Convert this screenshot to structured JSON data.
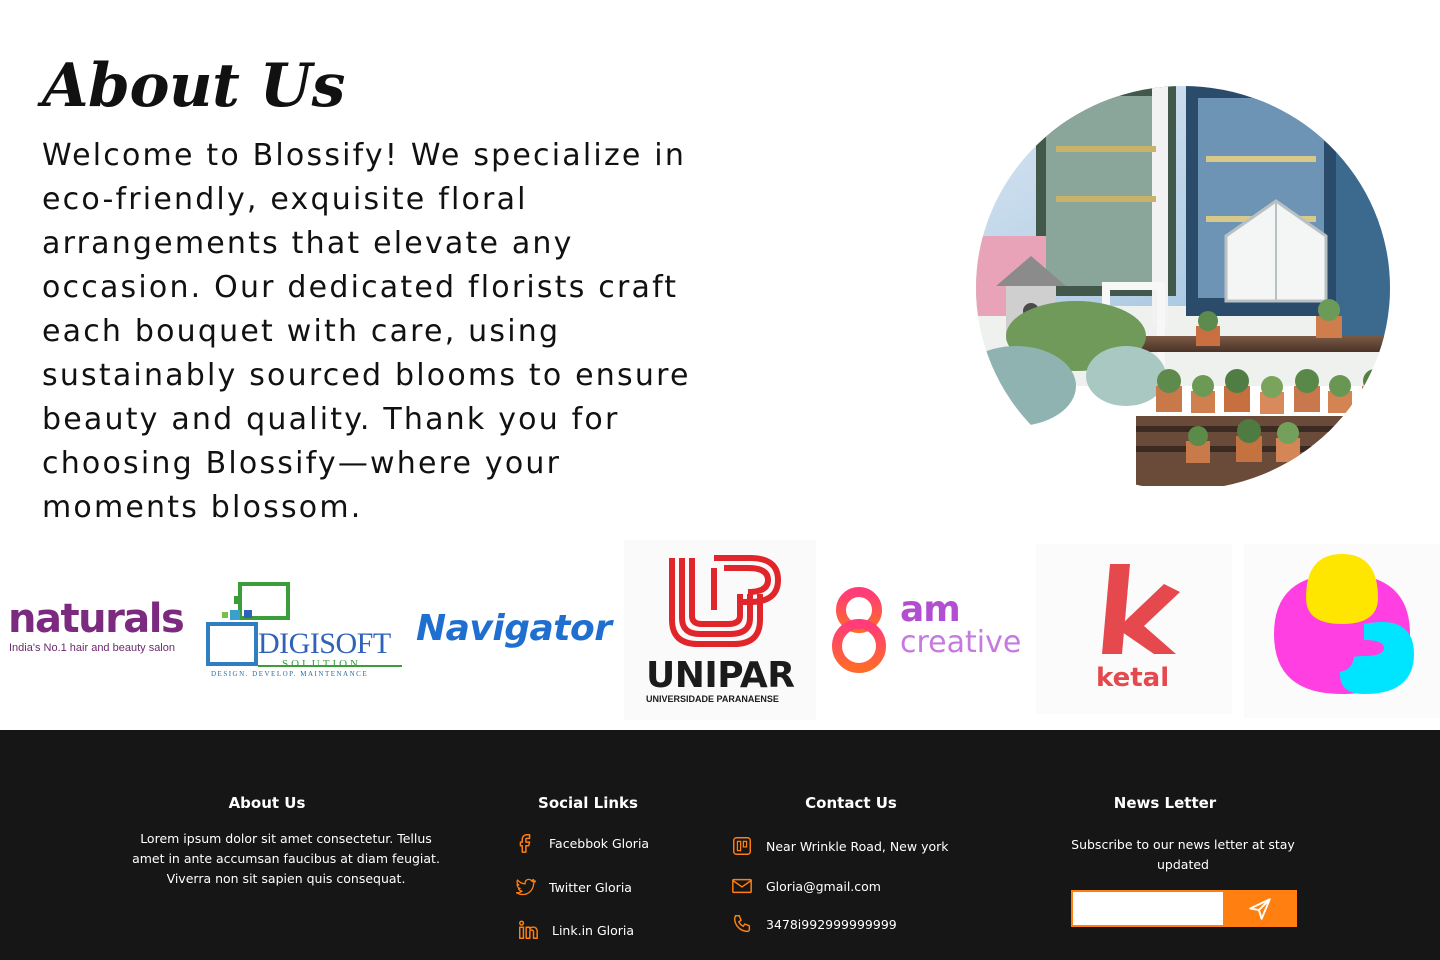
{
  "about": {
    "title": "About Us",
    "text": "Welcome to Blossify! We specialize in eco-friendly, exquisite floral arrangements that elevate any occasion. Our dedicated florists craft each bouquet with care, using sustainably sourced blooms to ensure beauty and quality. Thank you for choosing Blossify—where your moments blossom."
  },
  "logos": {
    "naturals": {
      "word": "naturals",
      "tagline": "India's No.1 hair and beauty salon"
    },
    "digisoft": {
      "word": "DIGISOFT",
      "sub": "SOLUTION",
      "tagline": "DESIGN. DEVELOP. MAINTENANCE"
    },
    "navigator": {
      "word": "Navigator"
    },
    "unipar": {
      "word": "UNIPAR",
      "sub": "UNIVERSIDADE PARANAENSE"
    },
    "eightam": {
      "numeral": "8",
      "word": "am",
      "sub": "creative"
    },
    "ketal": {
      "letter": "k",
      "word": "ketal"
    }
  },
  "footer": {
    "about": {
      "heading": "About Us",
      "text": "Lorem ipsum dolor sit amet consectetur. Tellus amet in ante accumsan faucibus at diam feugiat. Viverra non sit sapien quis consequat."
    },
    "social": {
      "heading": "Social Links",
      "links": [
        {
          "label": "Facebbok Gloria",
          "icon": "facebook-icon"
        },
        {
          "label": "Twitter Gloria",
          "icon": "twitter-icon"
        },
        {
          "label": "Link.in Gloria",
          "icon": "linkedin-icon"
        }
      ]
    },
    "contact": {
      "heading": "Contact Us",
      "items": [
        {
          "label": "Near Wrinkle Road, New york",
          "icon": "location-icon"
        },
        {
          "label": "Gloria@gmail.com",
          "icon": "mail-icon"
        },
        {
          "label": "3478i992999999999",
          "icon": "phone-icon"
        }
      ]
    },
    "newsletter": {
      "heading": "News Letter",
      "text": "Subscribe to our news letter at stay updated",
      "input_value": "",
      "send_icon": "send-icon"
    }
  },
  "colors": {
    "accent": "#ff7f11",
    "footer_bg": "#161616",
    "text_dark": "#111111"
  }
}
